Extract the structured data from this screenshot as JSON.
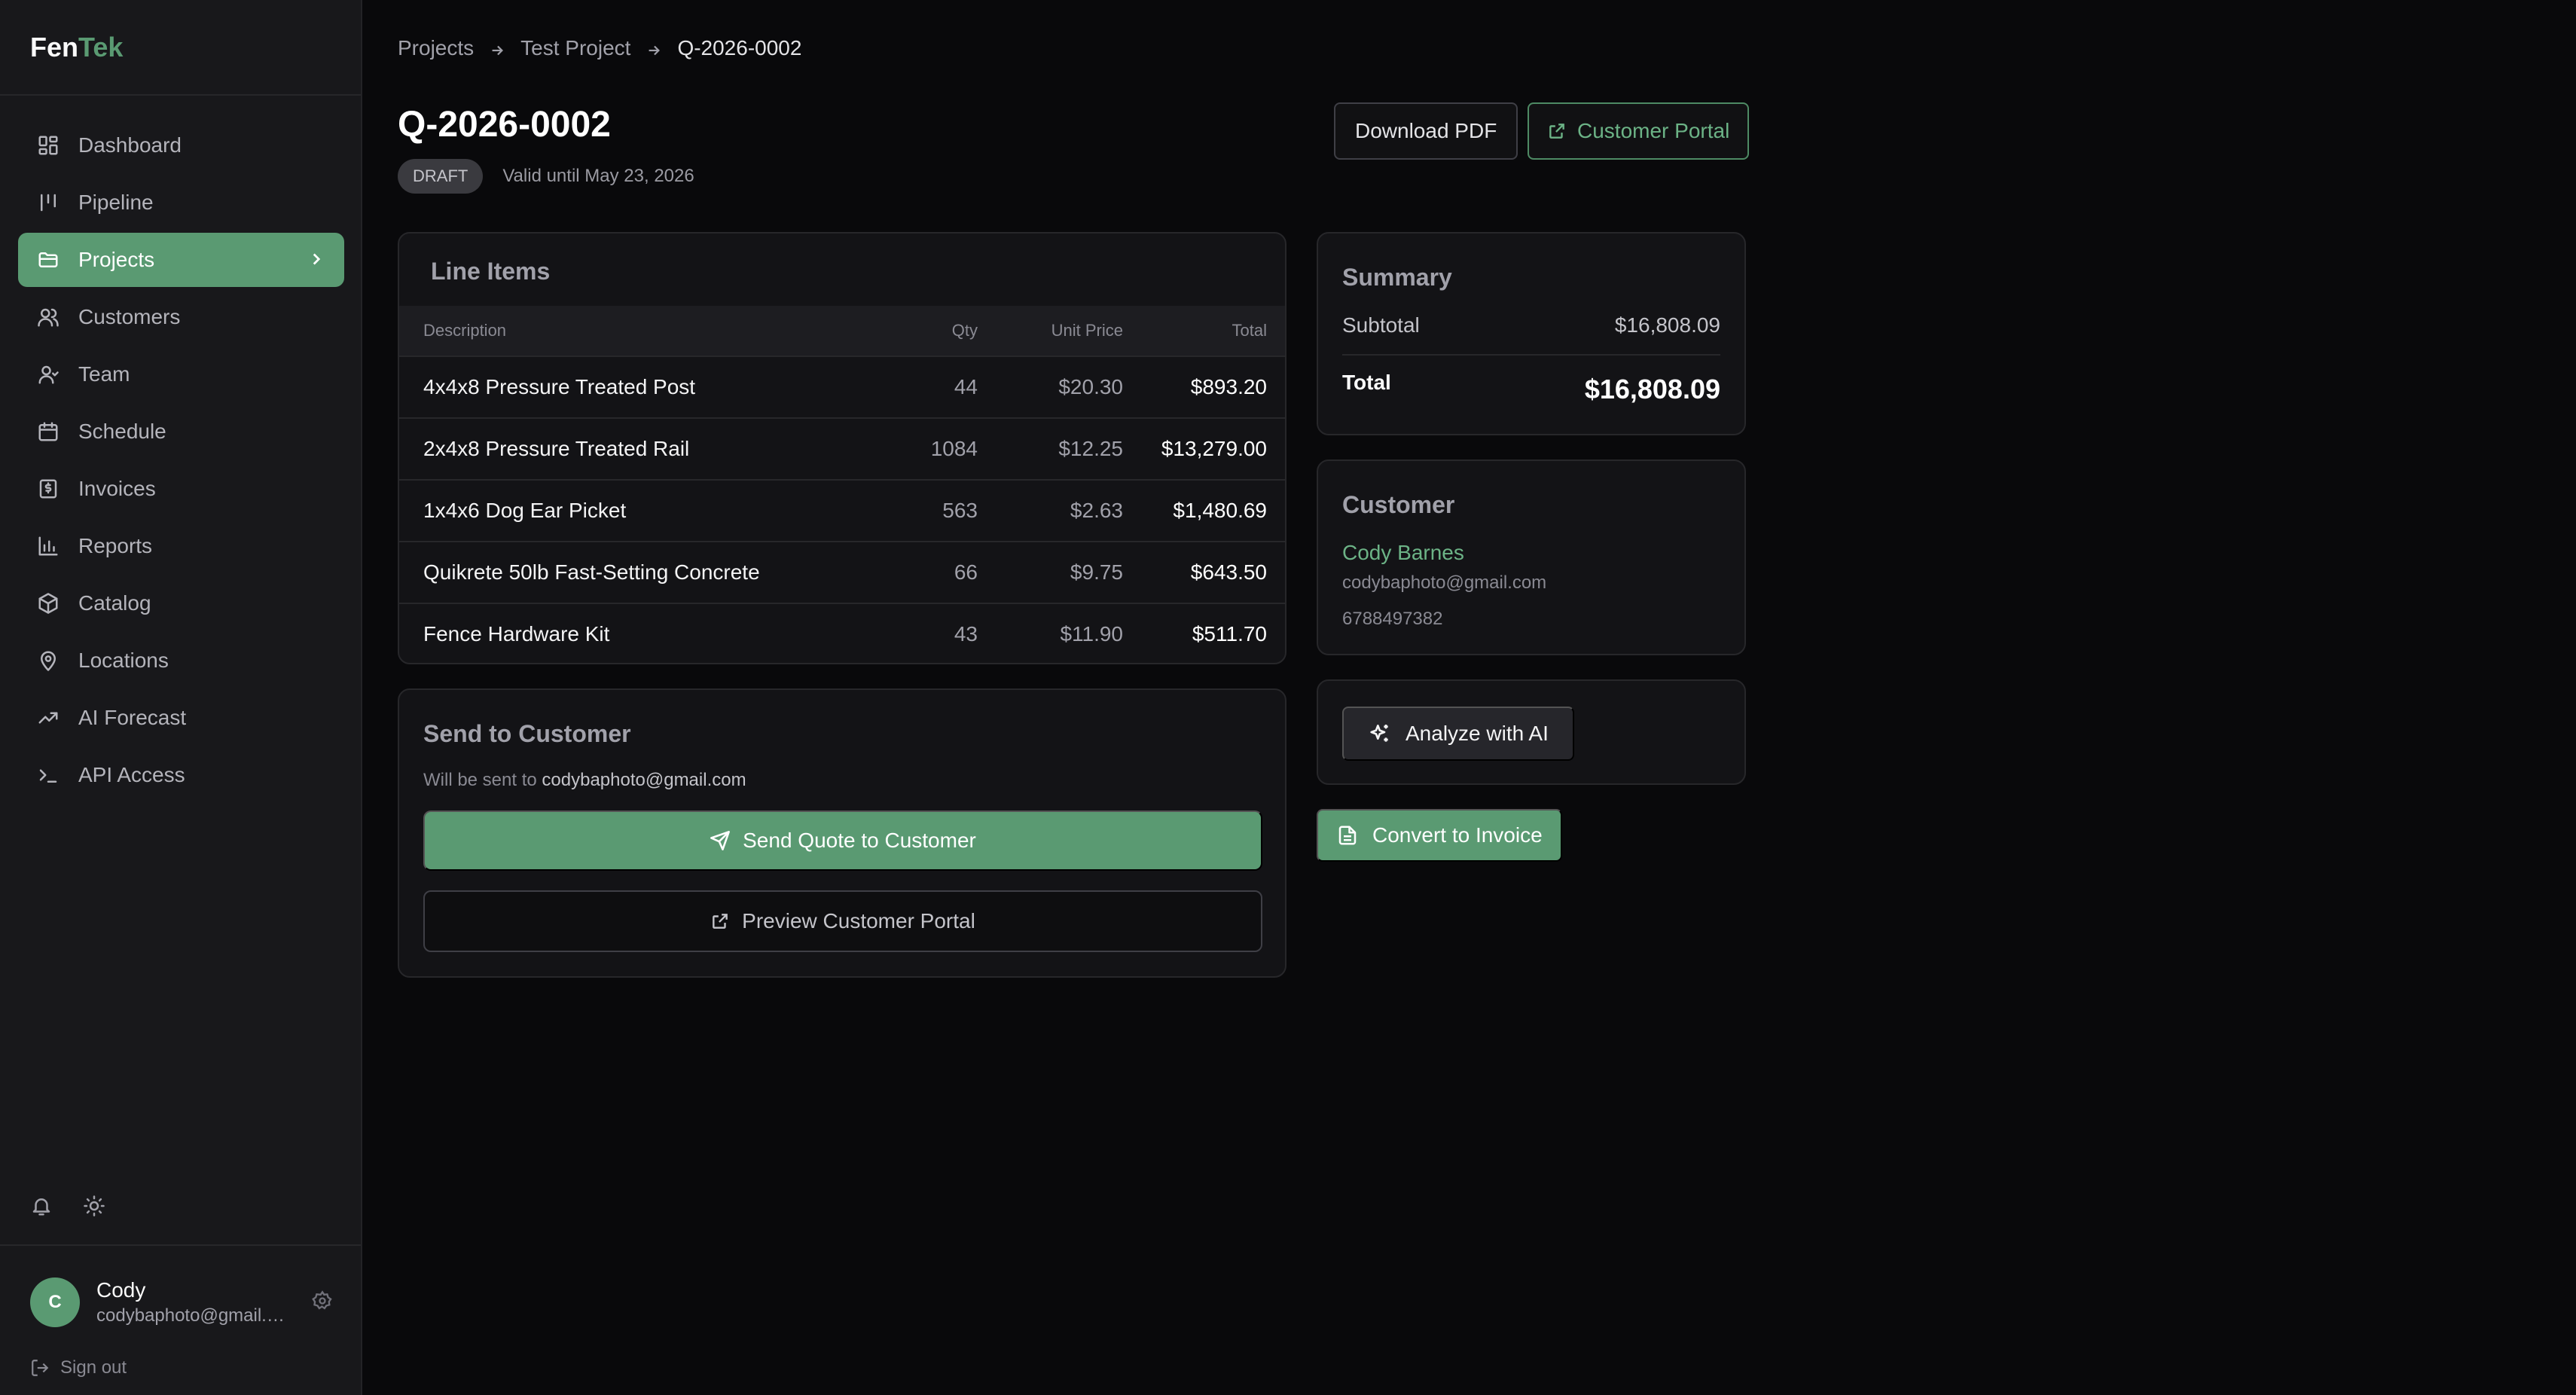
{
  "brand": {
    "part1": "Fen",
    "part2": "Tek"
  },
  "sidebar": {
    "items": [
      {
        "label": "Dashboard",
        "icon": "dashboard-icon"
      },
      {
        "label": "Pipeline",
        "icon": "pipeline-icon"
      },
      {
        "label": "Projects",
        "icon": "folder-icon",
        "active": true
      },
      {
        "label": "Customers",
        "icon": "users-icon"
      },
      {
        "label": "Team",
        "icon": "team-icon"
      },
      {
        "label": "Schedule",
        "icon": "calendar-icon"
      },
      {
        "label": "Invoices",
        "icon": "invoice-icon"
      },
      {
        "label": "Reports",
        "icon": "bar-chart-icon"
      },
      {
        "label": "Catalog",
        "icon": "package-icon"
      },
      {
        "label": "Locations",
        "icon": "map-pin-icon"
      },
      {
        "label": "AI Forecast",
        "icon": "trending-up-icon"
      },
      {
        "label": "API Access",
        "icon": "terminal-icon"
      }
    ],
    "user": {
      "initial": "C",
      "name": "Cody",
      "email": "codybaphoto@gmail.com"
    },
    "signout_label": "Sign out"
  },
  "breadcrumb": {
    "items": [
      "Projects",
      "Test Project",
      "Q-2026-0002"
    ]
  },
  "quote": {
    "number": "Q-2026-0002",
    "status": "DRAFT",
    "valid_until": "Valid until May 23, 2026"
  },
  "actions": {
    "download_label": "Download PDF",
    "portal_label": "Customer Portal"
  },
  "line_items": {
    "title": "Line Items",
    "headers": {
      "description": "Description",
      "qty": "Qty",
      "unit_price": "Unit Price",
      "total": "Total"
    },
    "rows": [
      {
        "description": "4x4x8 Pressure Treated Post",
        "qty": "44",
        "unit_price": "$20.30",
        "total": "$893.20"
      },
      {
        "description": "2x4x8 Pressure Treated Rail",
        "qty": "1084",
        "unit_price": "$12.25",
        "total": "$13,279.00"
      },
      {
        "description": "1x4x6 Dog Ear Picket",
        "qty": "563",
        "unit_price": "$2.63",
        "total": "$1,480.69"
      },
      {
        "description": "Quikrete 50lb Fast-Setting Concrete",
        "qty": "66",
        "unit_price": "$9.75",
        "total": "$643.50"
      },
      {
        "description": "Fence Hardware Kit",
        "qty": "43",
        "unit_price": "$11.90",
        "total": "$511.70"
      }
    ]
  },
  "send": {
    "title": "Send to Customer",
    "note_prefix": "Will be sent to ",
    "note_email": "codybaphoto@gmail.com",
    "send_label": "Send Quote to Customer",
    "preview_label": "Preview Customer Portal"
  },
  "summary": {
    "title": "Summary",
    "subtotal_label": "Subtotal",
    "subtotal": "$16,808.09",
    "total_label": "Total",
    "total": "$16,808.09"
  },
  "customer": {
    "title": "Customer",
    "name": "Cody Barnes",
    "email": "codybaphoto@gmail.com",
    "phone": "6788497382"
  },
  "ai": {
    "analyze_label": "Analyze with AI"
  },
  "convert_label": "Convert to Invoice",
  "colors": {
    "accent": "#5a9a72",
    "accent_text": "#6cb386",
    "background": "#09090b",
    "sidebar": "#18181b"
  }
}
